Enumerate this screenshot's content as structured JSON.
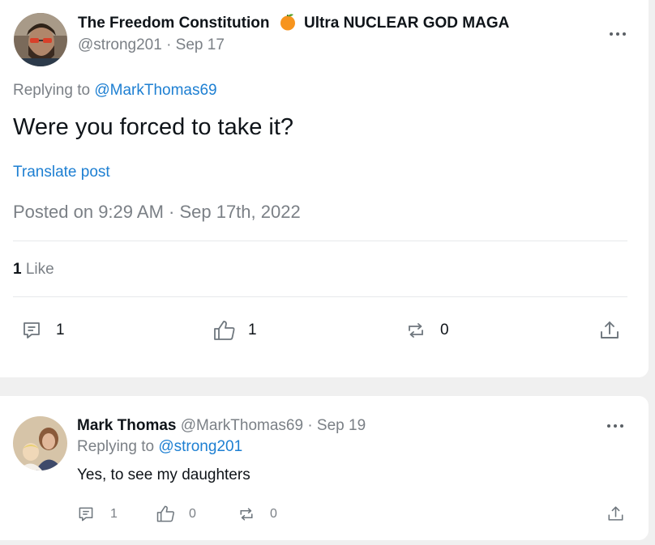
{
  "main_post": {
    "author": {
      "display_name": "The Freedom Constitution",
      "name_suffix": "Ultra NUCLEAR GOD MAGA",
      "emoji": "orange-fruit-emoji",
      "handle": "@strong201",
      "date": "· Sep 17"
    },
    "replying_prefix": "Replying to",
    "replying_handle": "@MarkThomas69",
    "body": "Were you forced to take it?",
    "translate_label": "Translate post",
    "posted_timestamp": "Posted on 9:29 AM · Sep 17th, 2022",
    "likes_count": "1",
    "likes_label": "Like",
    "actions": {
      "comments": "1",
      "likes": "1",
      "reposts": "0"
    }
  },
  "reply_post": {
    "author": {
      "display_name": "Mark Thomas",
      "handle": "@MarkThomas69",
      "date": "· Sep 19"
    },
    "replying_prefix": "Replying to",
    "replying_handle": "@strong201",
    "body": "Yes, to see my daughters",
    "actions": {
      "comments": "1",
      "likes": "0",
      "reposts": "0"
    }
  },
  "colors": {
    "link": "#1d7fd2",
    "muted_text": "#7b8086",
    "icon": "#6e767d",
    "background": "#f0f0f0",
    "card": "#ffffff"
  }
}
